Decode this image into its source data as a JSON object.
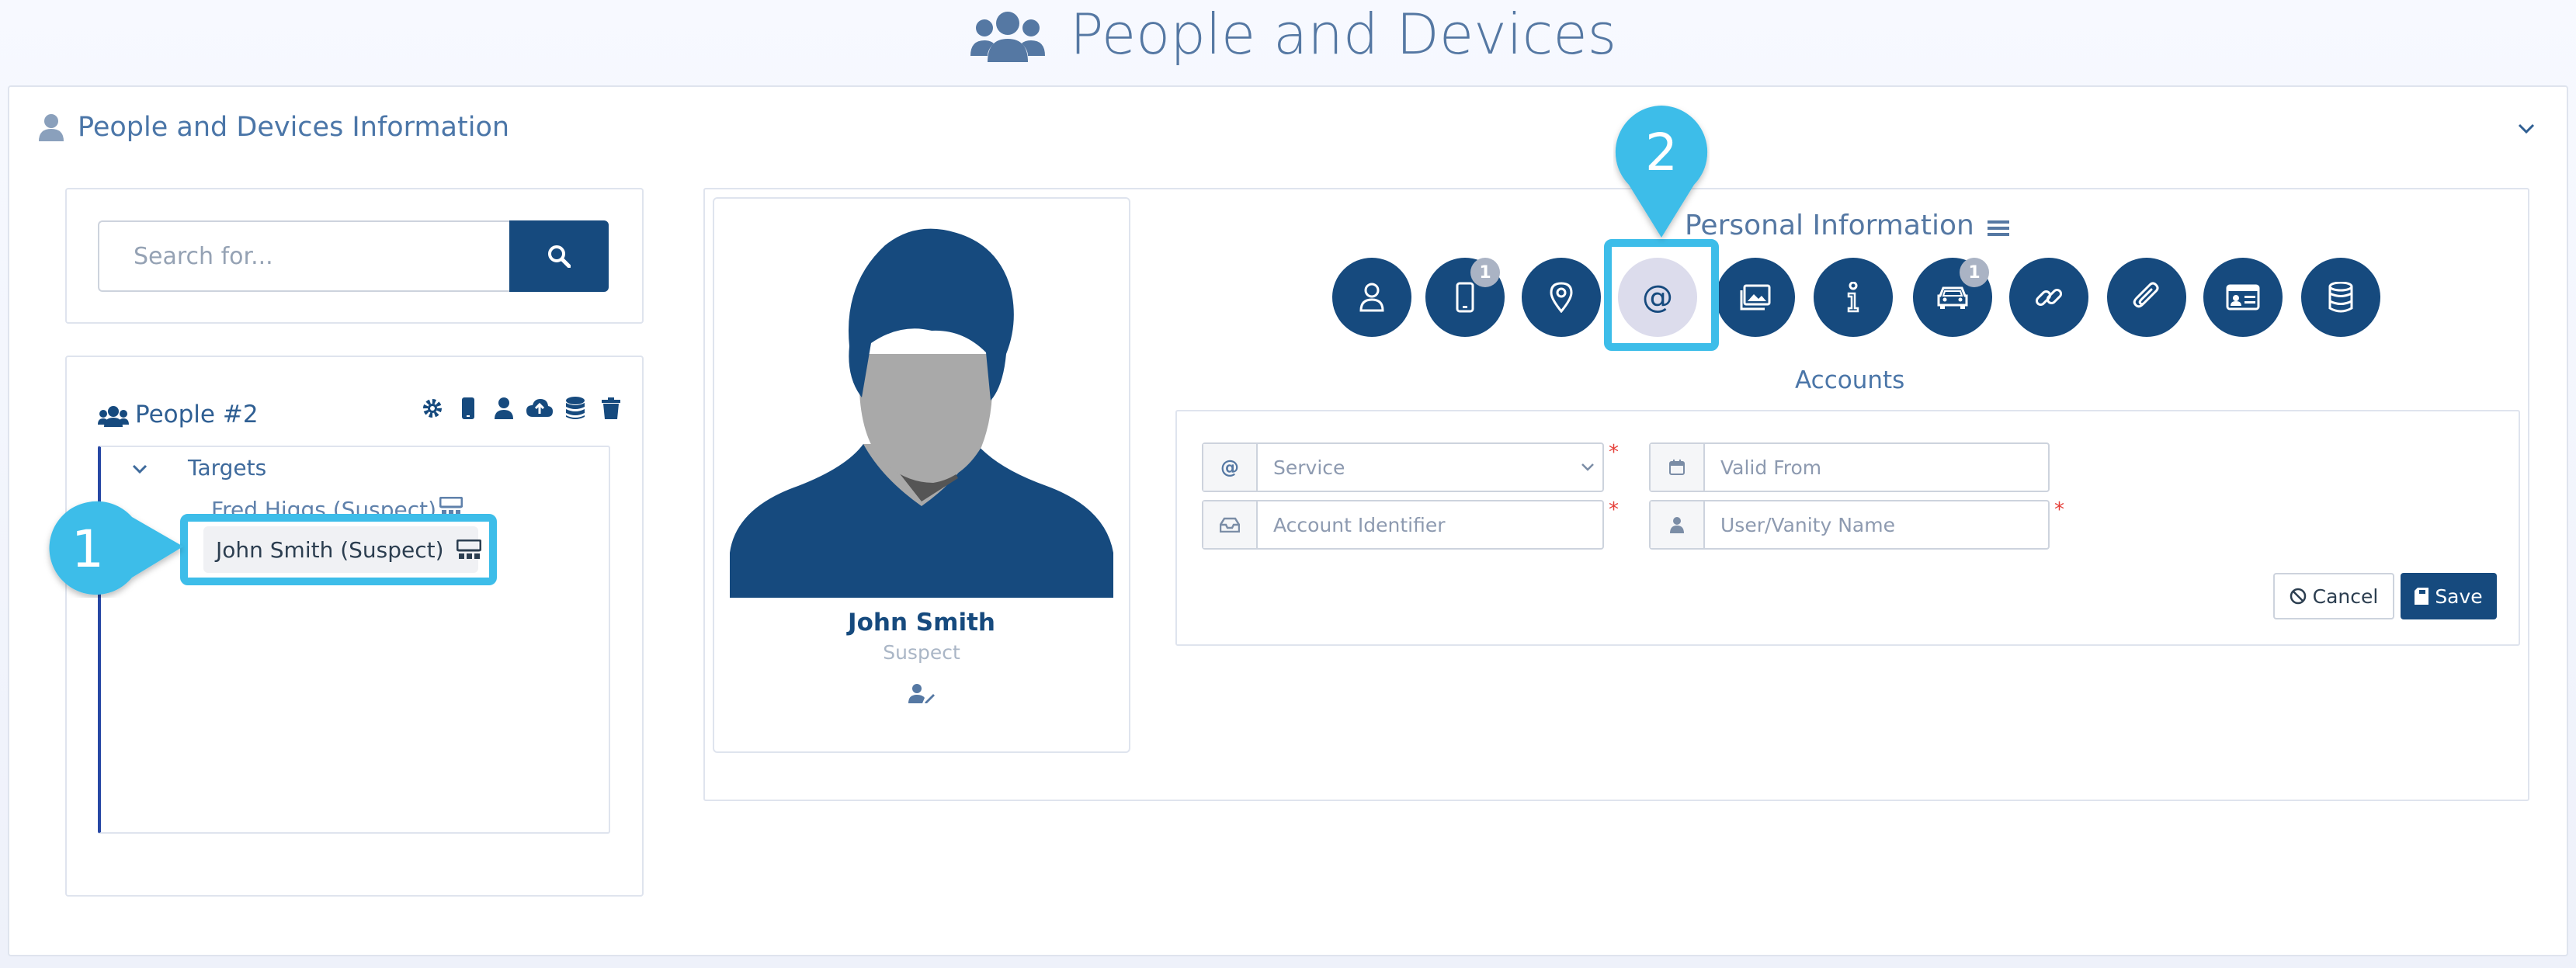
{
  "header": {
    "title": "People and Devices",
    "icon": "users-icon"
  },
  "panel": {
    "title": "People and Devices Information"
  },
  "search": {
    "placeholder": "Search for..."
  },
  "tree": {
    "title": "People #2",
    "group_label": "Targets",
    "items": [
      {
        "label": "Fred Higgs (Suspect)"
      },
      {
        "label": "John Smith (Suspect)"
      }
    ]
  },
  "callouts": {
    "first": "1",
    "second": "2"
  },
  "profile": {
    "name": "John Smith",
    "role": "Suspect"
  },
  "personal_info": {
    "title": "Personal Information",
    "tabs": [
      {
        "icon": "person-icon"
      },
      {
        "icon": "mobile-icon",
        "badge": "1"
      },
      {
        "icon": "location-icon"
      },
      {
        "icon": "at-icon",
        "active": true
      },
      {
        "icon": "images-icon"
      },
      {
        "icon": "info-icon"
      },
      {
        "icon": "car-icon",
        "badge": "1"
      },
      {
        "icon": "link-icon"
      },
      {
        "icon": "paperclip-icon"
      },
      {
        "icon": "id-card-icon"
      },
      {
        "icon": "database-icon"
      }
    ]
  },
  "accounts": {
    "title": "Accounts",
    "service_placeholder": "Service",
    "account_identifier_placeholder": "Account Identifier",
    "valid_from_placeholder": "Valid From",
    "vanity_name_placeholder": "User/Vanity Name",
    "required_mark": "*",
    "cancel_label": "Cancel",
    "save_label": "Save"
  },
  "colors": {
    "brand": "#164a7e",
    "callout": "#3dbde9",
    "accent_text": "#5578a3",
    "required": "#e5403a"
  }
}
